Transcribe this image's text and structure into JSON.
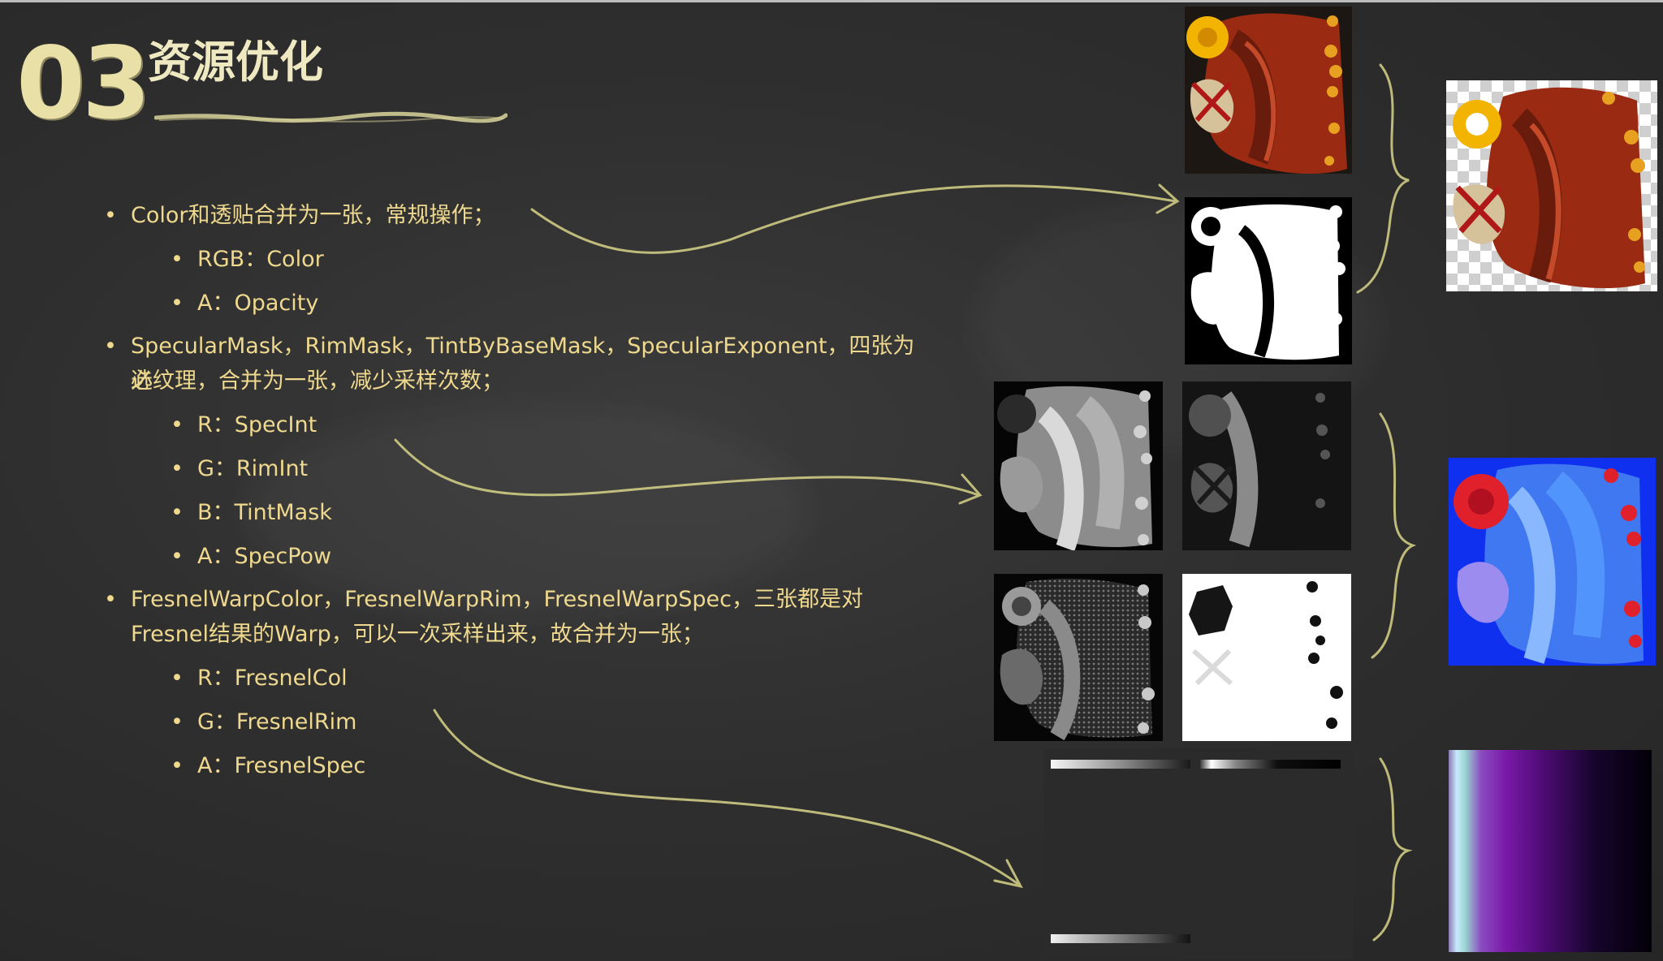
{
  "slide": {
    "number": "03",
    "title": "资源优化"
  },
  "bullets": [
    {
      "level": 1,
      "text": "Color和透贴合并为一张，常规操作；"
    },
    {
      "level": 2,
      "text": "RGB：Color"
    },
    {
      "level": 2,
      "text": "A：Opacity"
    },
    {
      "level": 1,
      "text": "SpecularMask，RimMask，TintByBaseMask，SpecularExponent，四张为必"
    },
    {
      "level": 1,
      "text": "选纹理，合并为一张，减少采样次数；",
      "continuation": true
    },
    {
      "level": 2,
      "text": "R：SpecInt"
    },
    {
      "level": 2,
      "text": "G：RimInt"
    },
    {
      "level": 2,
      "text": "B：TintMask"
    },
    {
      "level": 2,
      "text": "A：SpecPow"
    },
    {
      "level": 1,
      "text": "FresnelWarpColor，FresnelWarpRim，FresnelWarpSpec，三张都是对"
    },
    {
      "level": 1,
      "text": "Fresnel结果的Warp，可以一次采样出来，故合并为一张；",
      "continuation": true
    },
    {
      "level": 2,
      "text": "R：FresnelCol"
    },
    {
      "level": 2,
      "text": "G：FresnelRim"
    },
    {
      "level": 2,
      "text": "A：FresnelSpec"
    }
  ],
  "bullet_glyph": "•",
  "colors": {
    "chalk_text": "#efd98e",
    "title_chalk": "#efe9c2",
    "number_chalk": "#e8e0a6",
    "board": "#2f2f2f",
    "arrow_chalk": "#d8d488"
  },
  "textures": {
    "group1_inputs": [
      "color-texture",
      "opacity-mask-texture"
    ],
    "group1_output": "combined-color-opacity-texture",
    "group2_inputs": [
      "specular-mask-texture",
      "rim-mask-texture",
      "spec-exponent-texture",
      "tint-mask-texture"
    ],
    "group2_output": "combined-mask-texture",
    "group3_inputs": [
      "fresnel-warp-color-ramp",
      "fresnel-warp-rim-ramp",
      "fresnel-warp-spec-ramp"
    ],
    "group3_output": "combined-fresnel-warp-texture"
  }
}
